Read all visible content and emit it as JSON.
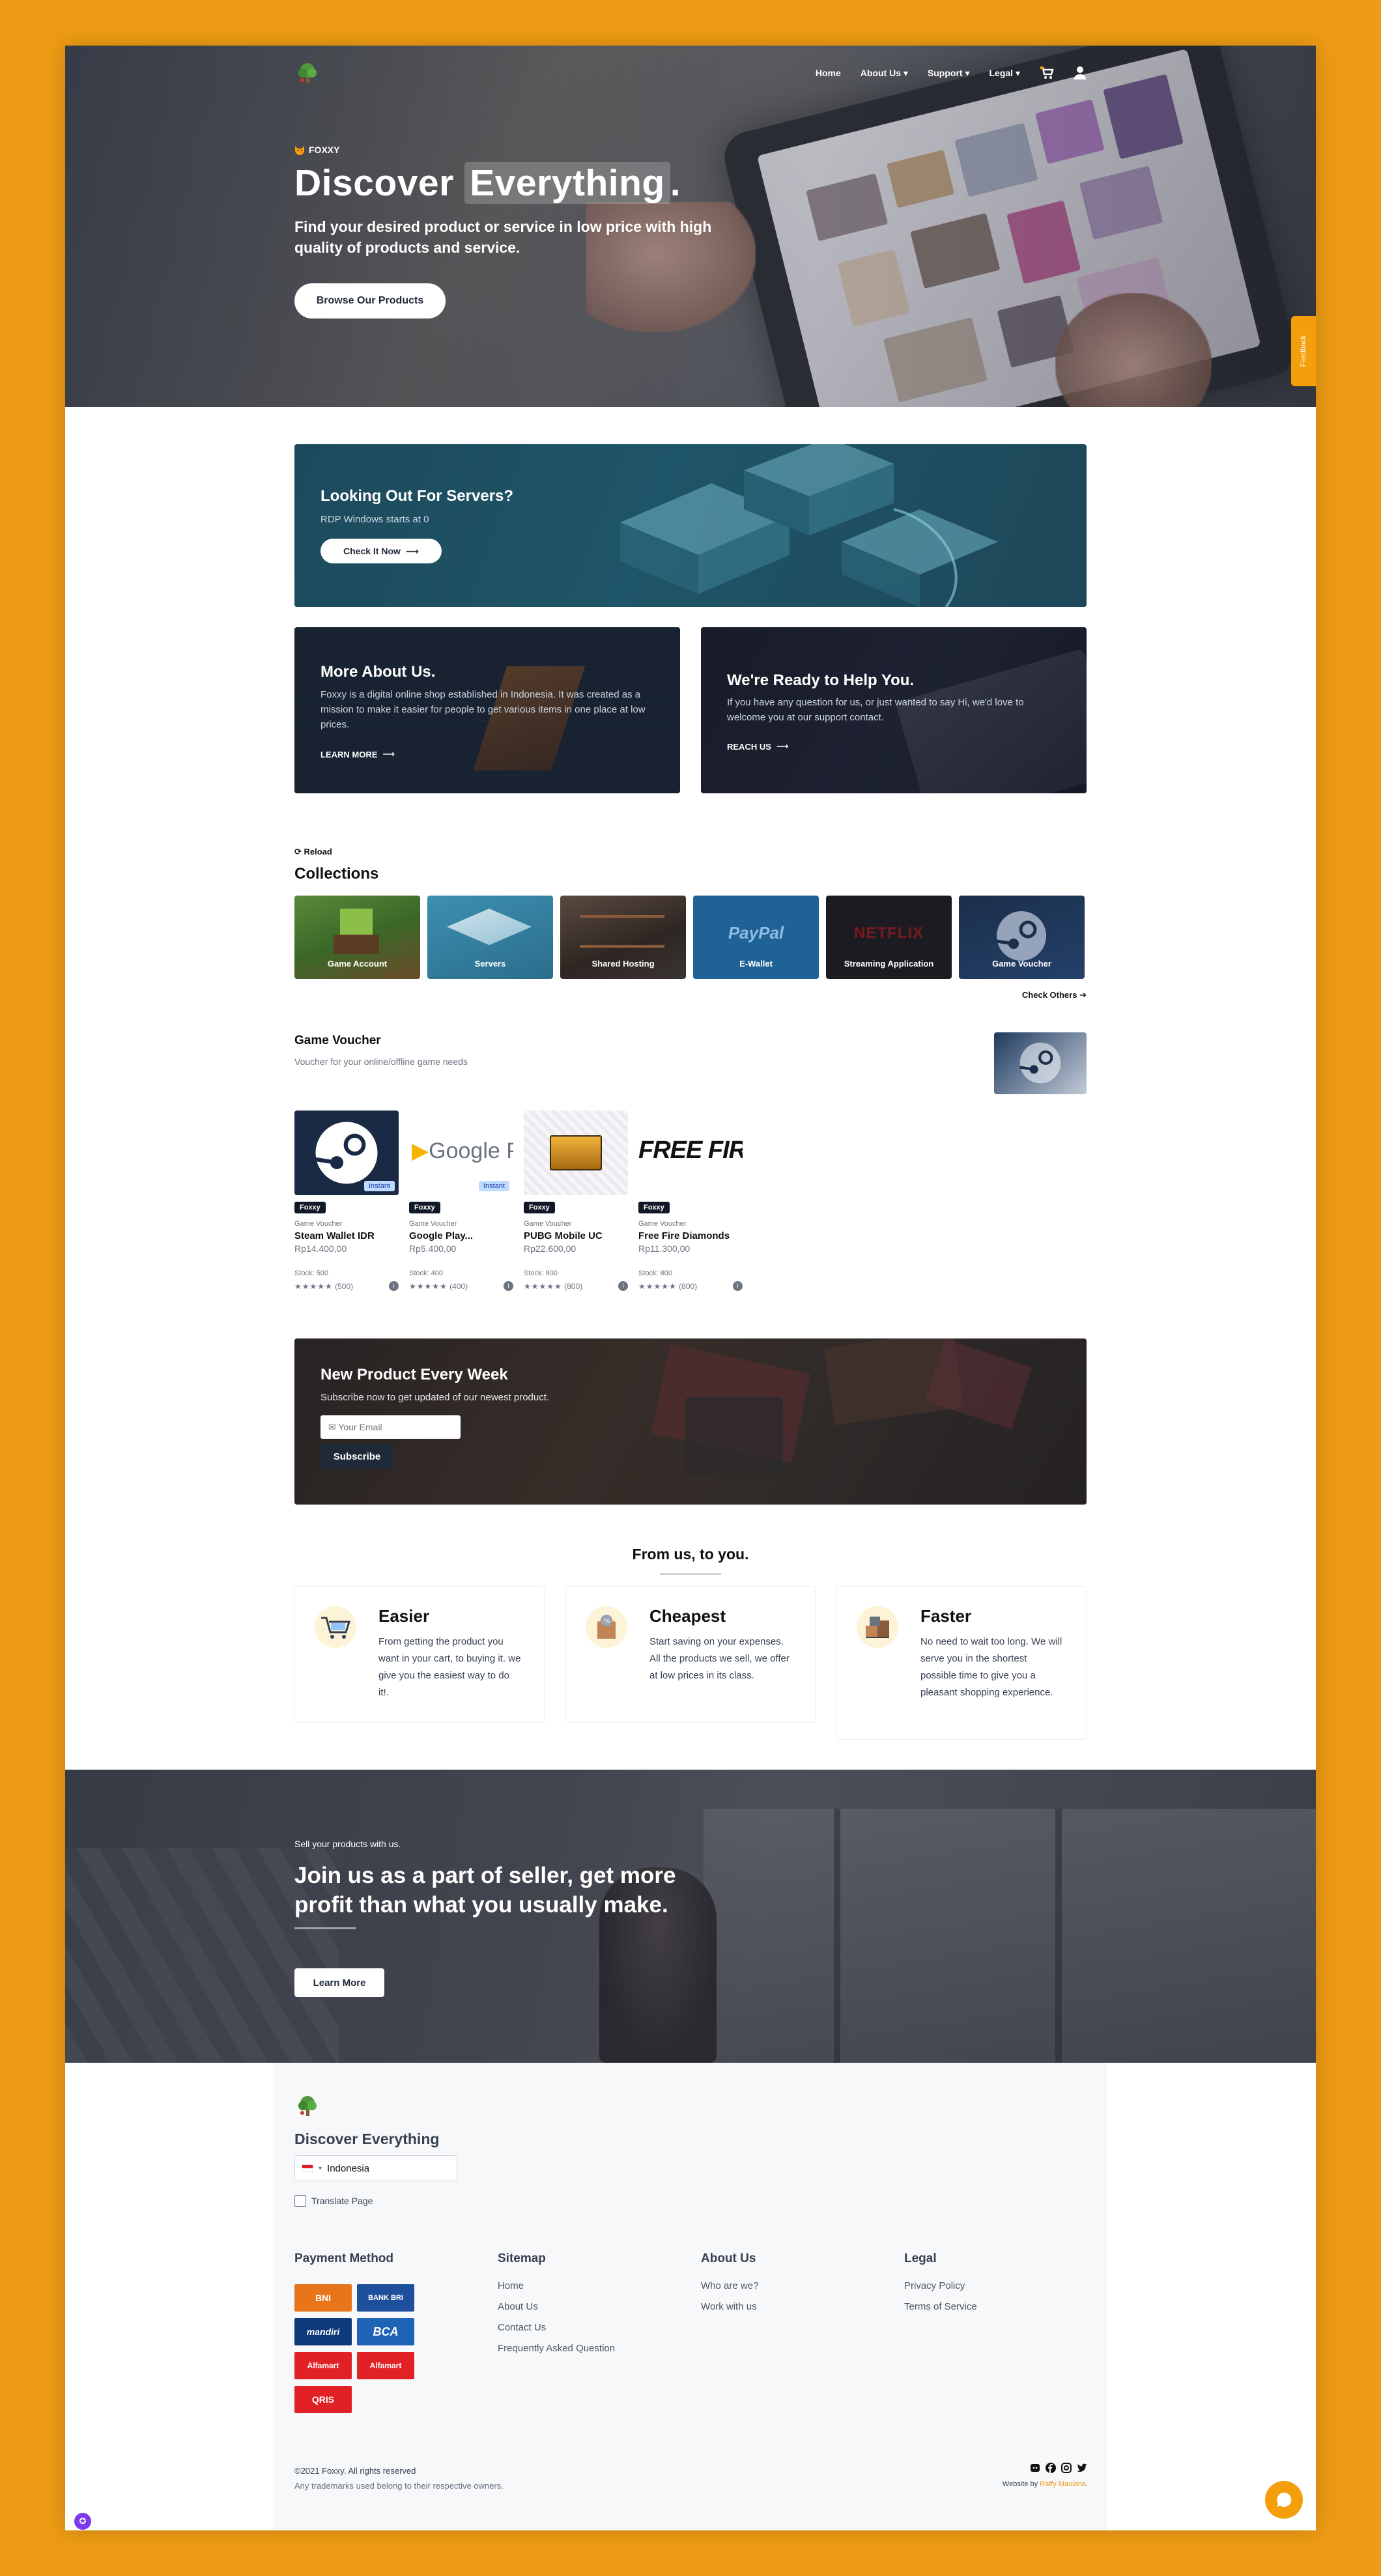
{
  "nav": {
    "items": [
      {
        "label": "Home",
        "caret": ""
      },
      {
        "label": "About Us",
        "caret": "▾"
      },
      {
        "label": "Support",
        "caret": "▾"
      },
      {
        "label": "Legal",
        "caret": "▾"
      }
    ],
    "cart_icon": "cart-icon",
    "user_icon": "user-icon"
  },
  "hero": {
    "brand": "FOXXY",
    "title_a": "Discover",
    "title_b": "Everything",
    "title_c": ".",
    "subtitle": "Find your desired product or service in low price with high quality of products and service.",
    "button": "Browse Our Products"
  },
  "feedback_tab": "Feedback",
  "banners": {
    "servers": {
      "title": "Looking Out For Servers?",
      "text": "RDP Windows starts at 0",
      "button": "Check It Now"
    },
    "about": {
      "title": "More About Us.",
      "text": "Foxxy is a digital online shop established in Indonesia. It was created as a mission to make it easier for people to get various items in one place at low prices.",
      "link": "LEARN MORE"
    },
    "help": {
      "title": "We're Ready to Help You.",
      "text": "If you have any question for us, or just wanted to say Hi, we'd love to welcome you at our support contact.",
      "link": "REACH US"
    }
  },
  "collections": {
    "reload": "Reload",
    "title": "Collections",
    "items": [
      "Game Account",
      "Servers",
      "Shared Hosting",
      "E-Wallet",
      "Streaming Application",
      "Game Voucher"
    ],
    "logo_paypal": "PayPal",
    "logo_netflix": "NETFLIX",
    "check_others": "Check Others"
  },
  "game_voucher": {
    "title": "Game Voucher",
    "subtitle": "Voucher for your online/offline game needs",
    "products": [
      {
        "name": "Steam Wallet IDR",
        "category": "Game Voucher",
        "price": "Rp14.400,00",
        "stock": "Stock: 500",
        "reviews": "(500)",
        "badge": "Instant",
        "seller": "Foxxy"
      },
      {
        "name": "Google Play...",
        "category": "Game Voucher",
        "price": "Rp5.400,00",
        "stock": "Stock: 400",
        "reviews": "(400)",
        "badge": "Instant",
        "seller": "Foxxy"
      },
      {
        "name": "PUBG Mobile UC",
        "category": "Game Voucher",
        "price": "Rp22.600,00",
        "stock": "Stock: 800",
        "reviews": "(800)",
        "badge": "",
        "seller": "Foxxy"
      },
      {
        "name": "Free Fire Diamonds",
        "category": "Game Voucher",
        "price": "Rp11.300,00",
        "stock": "Stock: 800",
        "reviews": "(800)",
        "badge": "",
        "seller": "Foxxy"
      }
    ],
    "google_play_logo": "Google Pl",
    "free_fire_logo": "FREE FIRE",
    "stars": "★★★★★"
  },
  "newsletter": {
    "title": "New Product Every Week",
    "subtitle": "Subscribe now to get updated of our newest product.",
    "placeholder": "✉ Your Email",
    "button": "Subscribe"
  },
  "features": {
    "title": "From us, to you.",
    "items": [
      {
        "title": "Easier",
        "text": "From getting the product you want in your cart, to buying it. we give you the easiest way to do it!."
      },
      {
        "title": "Cheapest",
        "text": "Start saving on your expenses. All the products we sell, we offer at low prices in its class."
      },
      {
        "title": "Faster",
        "text": "No need to wait too long. We will serve you in the shortest possible time to give you a pleasant shopping experience."
      }
    ]
  },
  "seller": {
    "small": "Sell your products with us.",
    "title": "Join us as a part of seller, get more profit than what you usually make.",
    "button": "Learn More"
  },
  "footer": {
    "brand": "Discover Everything",
    "country": "Indonesia",
    "translate": "Translate Page",
    "payment_title": "Payment Method",
    "payments": [
      "BNI",
      "BANK BRI",
      "mandiri",
      "BCA",
      "Alfamart",
      "Alfamart",
      "QRIS"
    ],
    "sitemap_title": "Sitemap",
    "sitemap": [
      "Home",
      "About Us",
      "Contact Us",
      "Frequently Asked Question"
    ],
    "about_title": "About Us",
    "about": [
      "Who are we?",
      "Work with us"
    ],
    "legal_title": "Legal",
    "legal": [
      "Privacy Policy",
      "Terms of Service"
    ],
    "copyright": "©2021 Foxxy. All rights reserved",
    "trademark": "Any trademarks used belong to their respective owners.",
    "website_by": "Website by",
    "author": "Raffy Maulana",
    "period": "."
  },
  "colors": {
    "brand_orange": "#ED9B14",
    "dark_navy": "#1f2937",
    "badge_blue": "#bfdbfe"
  }
}
